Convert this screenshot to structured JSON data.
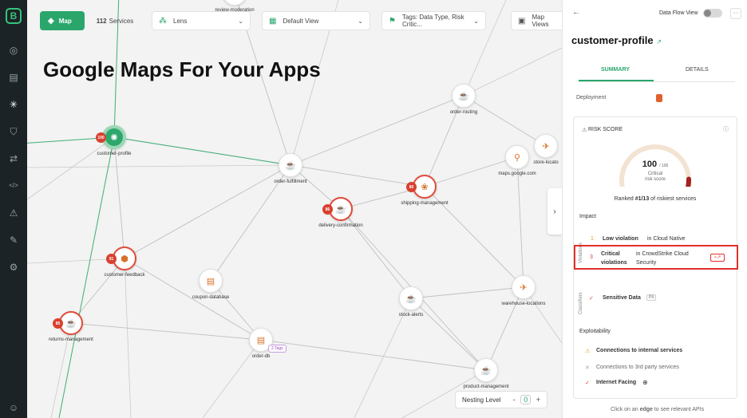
{
  "nav": {
    "logo": "B",
    "items": [
      {
        "name": "nav-target-icon",
        "glyph": "◎"
      },
      {
        "name": "nav-document-icon",
        "glyph": "▤"
      },
      {
        "name": "nav-graph-icon",
        "glyph": "✳"
      },
      {
        "name": "nav-shield-icon",
        "glyph": "⛉"
      },
      {
        "name": "nav-transfer-icon",
        "glyph": "⇄"
      },
      {
        "name": "nav-code-icon",
        "glyph": "</>"
      },
      {
        "name": "nav-alert-icon",
        "glyph": "⚠"
      },
      {
        "name": "nav-wand-icon",
        "glyph": "✎"
      },
      {
        "name": "nav-settings-icon",
        "glyph": "⚙"
      },
      {
        "name": "nav-user-icon",
        "glyph": "☺"
      }
    ]
  },
  "toolbar": {
    "map_label": "Map",
    "service_count": "112",
    "services_label": "Services",
    "lens_label": "Lens",
    "view_label": "Default View",
    "tags_label": "Tags: Data Type, Risk Critic...",
    "map_views_label": "Map Views"
  },
  "headline": "Google Maps For Your Apps",
  "nodes": [
    {
      "name": "customer-profile",
      "label": "customer-profile",
      "badge": "100"
    },
    {
      "name": "order-fulfillment",
      "label": "order-fulfillment",
      "badge": ""
    },
    {
      "name": "order-routing",
      "label": "order-routing",
      "badge": ""
    },
    {
      "name": "maps-google",
      "label": "maps.google.com",
      "badge": ""
    },
    {
      "name": "store-locator",
      "label": "store-locato",
      "badge": ""
    },
    {
      "name": "shipping-management",
      "label": "shipping-management",
      "badge": "80"
    },
    {
      "name": "delivery-confirmation",
      "label": "delivery-confirmation",
      "badge": "86"
    },
    {
      "name": "customer-feedback",
      "label": "customer-feedback",
      "badge": "91"
    },
    {
      "name": "coupon-database",
      "label": "coupon-database",
      "badge": ""
    },
    {
      "name": "warehouse-locations",
      "label": "warehouse-locations",
      "badge": ""
    },
    {
      "name": "stock-alerts",
      "label": "stock-alerts",
      "badge": ""
    },
    {
      "name": "returns-management",
      "label": "returns-management",
      "badge": "85"
    },
    {
      "name": "order-db",
      "label": "order-db",
      "badge": ""
    },
    {
      "name": "product-management",
      "label": "product-management",
      "badge": ""
    },
    {
      "name": "review-moderation",
      "label": "review-moderation",
      "badge": ""
    }
  ],
  "tags_badge": "2 Tags",
  "nesting": {
    "label": "Nesting Level",
    "value": "0",
    "minus": "-",
    "plus": "+"
  },
  "expand": "›",
  "panel": {
    "back": "←",
    "data_flow_view": "Data Flow View",
    "more": "···",
    "title": "customer-profile",
    "external": "↗",
    "tabs": [
      "SUMMARY",
      "DETAILS"
    ],
    "deployment_label": "Deployment",
    "risk_score_label": "RISK SCORE",
    "info": "ⓘ",
    "risk_value": "100",
    "risk_max": "/ 100",
    "risk_level": "Critical",
    "risk_sub": "risk score",
    "rank_prefix": "Ranked ",
    "rank_value": "#1/13",
    "rank_suffix": " of riskiest services",
    "impact_label": "Impact",
    "violations_label": "Violations",
    "classifiers_label": "Classifiers",
    "violation_rows": [
      {
        "count": "1",
        "level": "Low violation",
        "source": "in Cloud Native"
      },
      {
        "count": "3",
        "level": "Critical violations",
        "source": "in CrowdStrike Cloud Security"
      }
    ],
    "sensitive_data": "Sensitive Data",
    "pii": "PII",
    "exploitability_label": "Exploitability",
    "exploit_rows": [
      {
        "icon": "⚠",
        "text": "Connections to internal services"
      },
      {
        "icon": "✕",
        "text": "Connections to 3rd party services"
      },
      {
        "icon": "✓",
        "text": "Internet Facing"
      }
    ],
    "hint_prefix": "Click on an ",
    "hint_bold": "edge",
    "hint_suffix": " to see relevant APIs"
  },
  "colors": {
    "accent": "#2aa66b",
    "critical": "#d9402f"
  }
}
